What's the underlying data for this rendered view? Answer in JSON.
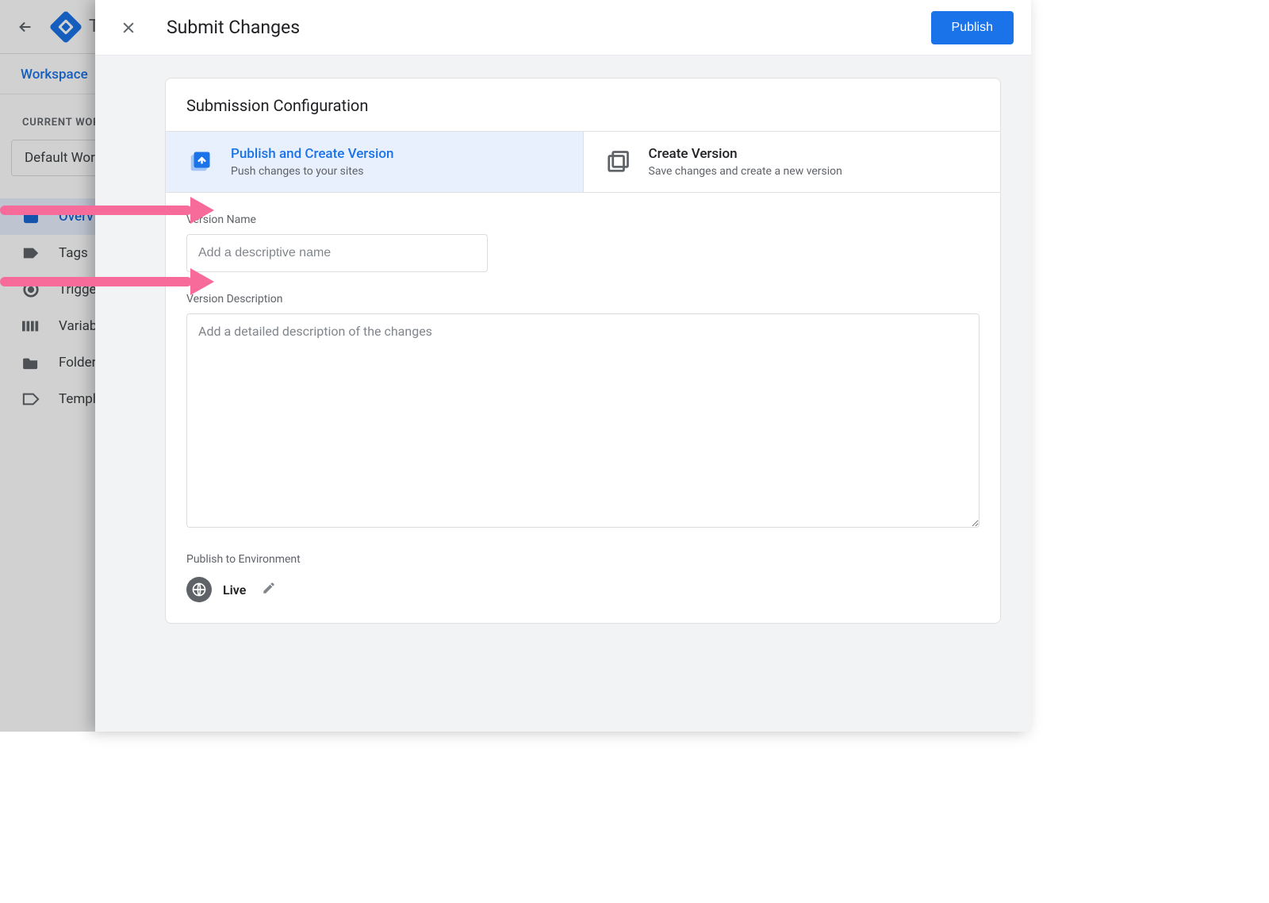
{
  "background": {
    "title_letter": "T",
    "tab_workspace": "Workspace",
    "current_ws_label": "CURRENT WOR",
    "ws_name": "Default Work",
    "nav": {
      "overview": "Overv",
      "tags": "Tags",
      "triggers": "Trigge",
      "variables": "Variab",
      "folders": "Folder",
      "templates": "Templ"
    }
  },
  "panel": {
    "title": "Submit Changes",
    "publish_btn": "Publish",
    "card_title": "Submission Configuration",
    "opt_publish": {
      "title": "Publish and Create Version",
      "sub": "Push changes to your sites"
    },
    "opt_create": {
      "title": "Create Version",
      "sub": "Save changes and create a new version"
    },
    "version_name_label": "Version Name",
    "version_name_placeholder": "Add a descriptive name",
    "version_desc_label": "Version Description",
    "version_desc_placeholder": "Add a detailed description of the changes",
    "env_label": "Publish to Environment",
    "env_name": "Live"
  }
}
